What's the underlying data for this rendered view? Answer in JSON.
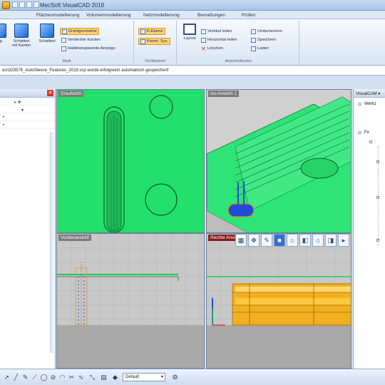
{
  "window": {
    "title": "MecSoft VisualCAD 2018"
  },
  "ribbon_tabs": [
    "Flächenmodellierung",
    "Volumenmodellierung",
    "Netzmodellierung",
    "Bemaßungen",
    "Prüfen"
  ],
  "ribbon": {
    "modus": {
      "label": "Modi",
      "big_buttons": [
        "Schattiert mit Kanten",
        "Schattiert"
      ],
      "first_button_partial": "p.",
      "options": [
        {
          "label": "Drahtgeometrie",
          "active": true
        },
        {
          "label": "Verdeckte Kanten",
          "active": false
        },
        {
          "label": "Halbtransparente Anzeige",
          "active": false
        }
      ]
    },
    "sichtbarkeit": {
      "label": "Sichtbarkeit",
      "options": [
        {
          "label": "K-Ebene",
          "active": true
        },
        {
          "label": "Koord. Sys.",
          "active": true
        }
      ]
    },
    "ansichtsfenster": {
      "label": "Ansichtsfenster",
      "layout_label": "Layout",
      "items_col1": [
        "Vertikal teilen",
        "Horizontal teilen",
        "Löschen"
      ],
      "items_col2": [
        "Umbenennen",
        "Speichern",
        "Laden"
      ]
    }
  },
  "message": "ws\\323578_AutoSleeve_Features_2018.vcp wurde erfolgreich automatisch gespeichert!",
  "right_panel": {
    "title": "VisualCAM ▾",
    "items": [
      "Werkz",
      "Fe"
    ]
  },
  "viewports": [
    {
      "label": "Draufsicht",
      "active": false
    },
    {
      "label": "Iso Ansicht 1",
      "active": false
    },
    {
      "label": "Vorderansicht",
      "active": false
    },
    {
      "label": "Rechte Ansicht",
      "active": true
    }
  ],
  "bottom_toolbar": {
    "layer_select": "Default"
  },
  "colors": {
    "green_face": "#22e06b",
    "grid_bg": "#c9c9c9",
    "highlight_orange": "#ffd57a"
  }
}
